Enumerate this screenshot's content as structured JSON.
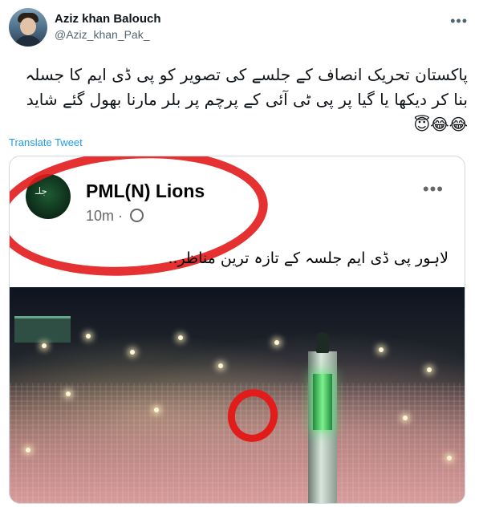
{
  "author": {
    "display_name": "Aziz khan Balouch",
    "handle": "@Aziz_khan_Pak_"
  },
  "tweet": {
    "text": "پاکستان تحریک انصاف کے جلسے کی  تصویر کو پی ڈی ایم کا جسلہ بنا کر دیکھا یا گیا پر پی ٹی آئی کے پرچم پر بلر مارنا بھول گئے شاید 😂😂😇",
    "translate_label": "Translate Tweet"
  },
  "embedded_post": {
    "page_name": "PML(N) Lions",
    "time": "10m",
    "caption": "لاہور پی ڈی ایم جلسہ کے تازہ ترین مناظر.."
  },
  "icons": {
    "more": "more-horizontal-icon",
    "globe": "globe-icon"
  },
  "colors": {
    "link": "#1d9bf0",
    "annotation_red": "#e21b1b"
  }
}
